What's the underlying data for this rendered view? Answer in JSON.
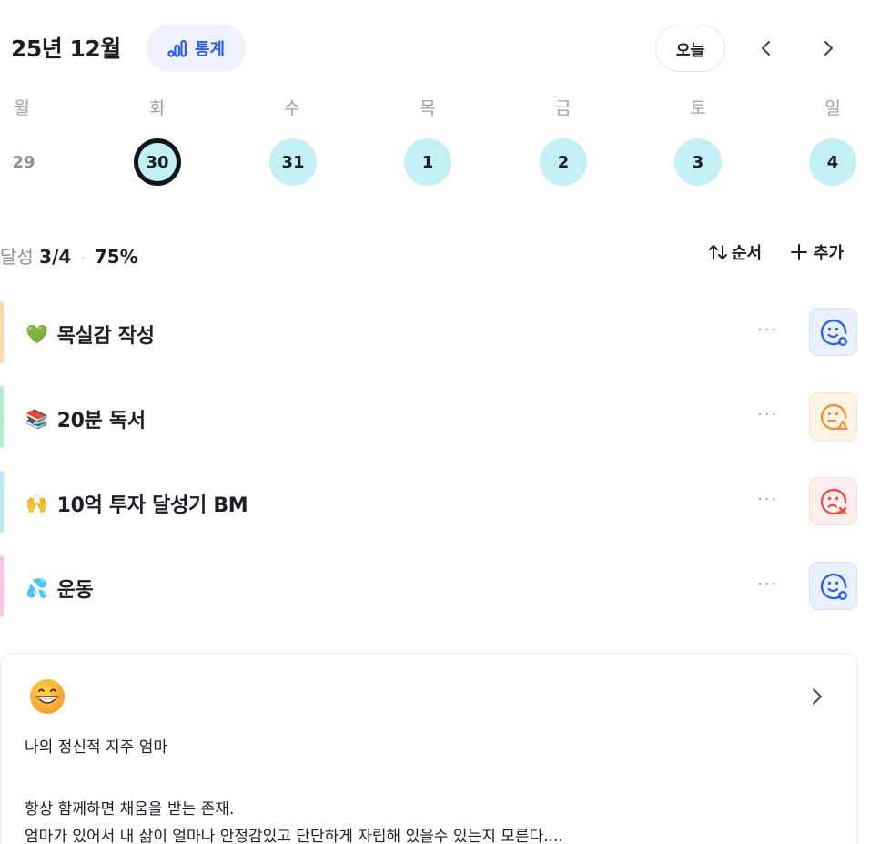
{
  "header": {
    "month_title": "25년 12월",
    "stats_label": "통계",
    "today_label": "오늘"
  },
  "calendar": {
    "weekdays": [
      "월",
      "화",
      "수",
      "목",
      "금",
      "토",
      "일"
    ],
    "dates": [
      "29",
      "30",
      "31",
      "1",
      "2",
      "3",
      "4"
    ],
    "selected_date": "30"
  },
  "summary": {
    "label": "달성",
    "count": "3/4",
    "separator": "·",
    "percent": "75%",
    "order_label": "순서",
    "add_label": "추가"
  },
  "habits": [
    {
      "emoji": "💚",
      "title": "목실감 작성",
      "bar_color": "#fcd9b0",
      "status": "done",
      "face_bg": "#eaf0fe",
      "face_border": "#d7e1fb",
      "face_color": "#2f63e6"
    },
    {
      "emoji": "📚",
      "title": "20분 독서",
      "bar_color": "#b6ecd0",
      "status": "warning",
      "face_bg": "#fff4e4",
      "face_border": "#fde3bd",
      "face_color": "#f1912a"
    },
    {
      "emoji": "🙌",
      "title": "10억 투자 달성기 BM",
      "bar_color": "#bfe9f6",
      "status": "failed",
      "face_bg": "#fdeeee",
      "face_border": "#f9d9d8",
      "face_color": "#e94c45"
    },
    {
      "emoji": "💦",
      "title": "운동",
      "bar_color": "#f7c6e0",
      "status": "done",
      "face_bg": "#eaf0fe",
      "face_border": "#d7e1fb",
      "face_color": "#2f63e6"
    }
  ],
  "diary": {
    "emoji": "😁",
    "title": "나의 정신적 지주 엄마",
    "line1": "항상 함께하면 채움을 받는 존재.",
    "line2": "엄마가 있어서 내 삶이 얼마나 안정감있고 단단하게 자립해 있을수 있는지 모른다...."
  },
  "icons": {
    "stats": "bar-chart-icon",
    "prev": "chevron-left-icon",
    "next": "chevron-right-icon",
    "order": "sort-arrows-icon",
    "add": "plus-icon",
    "more": "more-dots-icon",
    "diary_open": "chevron-right-icon"
  }
}
